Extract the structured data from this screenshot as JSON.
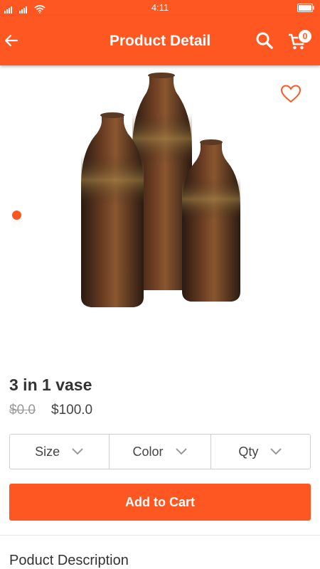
{
  "status_bar": {
    "time": "4:11",
    "icons": [
      "signal-icon",
      "wifi-icon",
      "battery-icon"
    ]
  },
  "app_bar": {
    "title": "Product Detail",
    "back_icon": "arrow-left-icon",
    "search_icon": "search-icon",
    "cart_icon": "cart-icon",
    "cart_count": "0"
  },
  "product": {
    "image_subject": "three tall ceramic vases",
    "name": "3 in 1 vase",
    "original_price": "$0.0",
    "price": "$100.0",
    "favorite_icon": "heart-outline-icon"
  },
  "options": [
    {
      "label": "Size"
    },
    {
      "label": "Color"
    },
    {
      "label": "Qty"
    }
  ],
  "actions": {
    "add_to_cart": "Add to Cart"
  },
  "description": {
    "title": "Poduct Description"
  },
  "colors": {
    "accent": "#ff5722",
    "text": "#333333",
    "muted": "#999999",
    "border": "#cfcfcf"
  }
}
